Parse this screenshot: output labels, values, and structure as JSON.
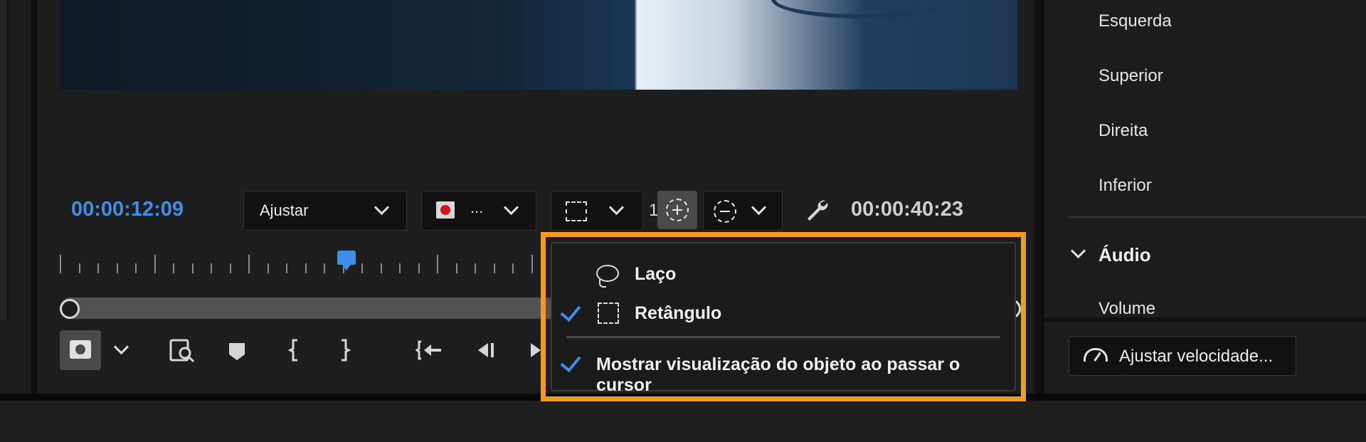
{
  "monitor": {
    "current_timecode": "00:00:12:09",
    "total_timecode": "00:00:40:23",
    "zoom_dropdown": {
      "label": "Ajustar"
    },
    "quality_dropdown": {
      "label": "..."
    },
    "partial_digit": "1",
    "icons": {
      "selection": "rectangle-select-icon",
      "add_selection": "add-selection-icon",
      "subtract_selection": "subtract-selection-icon",
      "settings": "wrench-icon"
    },
    "transport_icons": [
      "capture-frame-icon",
      "zoom-icon",
      "marker-icon",
      "mark-in-icon",
      "mark-out-icon",
      "go-to-in-icon",
      "step-back-icon",
      "play-icon"
    ]
  },
  "selection_menu": {
    "items": [
      {
        "label": "Laço",
        "checked": false,
        "icon": "lasso-icon"
      },
      {
        "label": "Retângulo",
        "checked": true,
        "icon": "rectangle-select-icon"
      },
      {
        "label": "Mostrar visualização do objeto ao passar o cursor",
        "checked": true
      }
    ],
    "highlight_color": "#f29a26"
  },
  "right_panel": {
    "labels": [
      "Esquerda",
      "Superior",
      "Direita",
      "Inferior"
    ],
    "audio_section": "Áudio",
    "volume_label": "Volume",
    "speed_button": "Ajustar velocidade..."
  },
  "colors": {
    "accent_blue": "#3f8ee8",
    "background": "#1d1d1d",
    "record_red": "#d4141c"
  }
}
